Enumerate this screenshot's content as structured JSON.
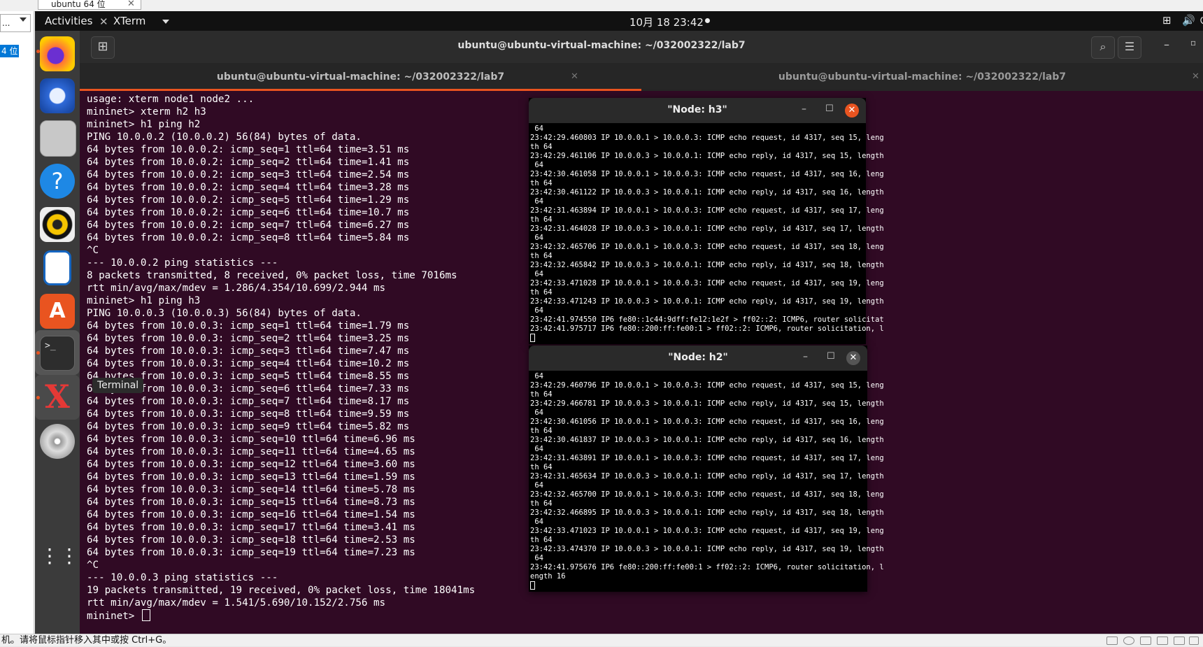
{
  "host": {
    "tab_title": "ubuntu 64 位",
    "left_select": "...",
    "left_item": "4 位",
    "status_text": "机。请将鼠标指针移入其中或按 Ctrl+G。"
  },
  "topbar": {
    "activities": "Activities",
    "app_name": "XTerm",
    "clock": "10月 18  23:42"
  },
  "dock": {
    "tooltip": "Terminal",
    "icons": [
      "firefox-icon",
      "thunderbird-icon",
      "files-icon",
      "help-icon",
      "rhythmbox-icon",
      "writer-icon",
      "software-icon",
      "terminal-icon",
      "xterm-icon",
      "dvd-icon",
      "show-apps-icon"
    ]
  },
  "terminal": {
    "title": "ubuntu@ubuntu-virtual-machine: ~/032002322/lab7",
    "tabs": [
      {
        "label": "ubuntu@ubuntu-virtual-machine: ~/032002322/lab7"
      },
      {
        "label": "ubuntu@ubuntu-virtual-machine: ~/032002322/lab7"
      }
    ],
    "lines": [
      "usage: xterm node1 node2 ...",
      "mininet> xterm h2 h3",
      "mininet> h1 ping h2",
      "PING 10.0.0.2 (10.0.0.2) 56(84) bytes of data.",
      "64 bytes from 10.0.0.2: icmp_seq=1 ttl=64 time=3.51 ms",
      "64 bytes from 10.0.0.2: icmp_seq=2 ttl=64 time=1.41 ms",
      "64 bytes from 10.0.0.2: icmp_seq=3 ttl=64 time=2.54 ms",
      "64 bytes from 10.0.0.2: icmp_seq=4 ttl=64 time=3.28 ms",
      "64 bytes from 10.0.0.2: icmp_seq=5 ttl=64 time=1.29 ms",
      "64 bytes from 10.0.0.2: icmp_seq=6 ttl=64 time=10.7 ms",
      "64 bytes from 10.0.0.2: icmp_seq=7 ttl=64 time=6.27 ms",
      "64 bytes from 10.0.0.2: icmp_seq=8 ttl=64 time=5.84 ms",
      "^C",
      "--- 10.0.0.2 ping statistics ---",
      "8 packets transmitted, 8 received, 0% packet loss, time 7016ms",
      "rtt min/avg/max/mdev = 1.286/4.354/10.699/2.944 ms",
      "mininet> h1 ping h3",
      "PING 10.0.0.3 (10.0.0.3) 56(84) bytes of data.",
      "64 bytes from 10.0.0.3: icmp_seq=1 ttl=64 time=1.79 ms",
      "64 bytes from 10.0.0.3: icmp_seq=2 ttl=64 time=3.25 ms",
      "64 bytes from 10.0.0.3: icmp_seq=3 ttl=64 time=7.47 ms",
      "64 bytes from 10.0.0.3: icmp_seq=4 ttl=64 time=10.2 ms",
      "64 bytes from 10.0.0.3: icmp_seq=5 ttl=64 time=8.55 ms",
      "64 bytes from 10.0.0.3: icmp_seq=6 ttl=64 time=7.33 ms",
      "64 bytes from 10.0.0.3: icmp_seq=7 ttl=64 time=8.17 ms",
      "64 bytes from 10.0.0.3: icmp_seq=8 ttl=64 time=9.59 ms",
      "64 bytes from 10.0.0.3: icmp_seq=9 ttl=64 time=5.82 ms",
      "64 bytes from 10.0.0.3: icmp_seq=10 ttl=64 time=6.96 ms",
      "64 bytes from 10.0.0.3: icmp_seq=11 ttl=64 time=4.65 ms",
      "64 bytes from 10.0.0.3: icmp_seq=12 ttl=64 time=3.60 ms",
      "64 bytes from 10.0.0.3: icmp_seq=13 ttl=64 time=1.59 ms",
      "64 bytes from 10.0.0.3: icmp_seq=14 ttl=64 time=5.78 ms",
      "64 bytes from 10.0.0.3: icmp_seq=15 ttl=64 time=8.73 ms",
      "64 bytes from 10.0.0.3: icmp_seq=16 ttl=64 time=1.54 ms",
      "64 bytes from 10.0.0.3: icmp_seq=17 ttl=64 time=3.41 ms",
      "64 bytes from 10.0.0.3: icmp_seq=18 ttl=64 time=2.53 ms",
      "64 bytes from 10.0.0.3: icmp_seq=19 ttl=64 time=7.23 ms",
      "^C",
      "--- 10.0.0.3 ping statistics ---",
      "19 packets transmitted, 19 received, 0% packet loss, time 18041ms",
      "rtt min/avg/max/mdev = 1.541/5.690/10.152/2.756 ms"
    ],
    "prompt": "mininet> "
  },
  "xterm_h3": {
    "title": "\"Node: h3\"",
    "lines": [
      " 64",
      "23:42:29.460803 IP 10.0.0.1 > 10.0.0.3: ICMP echo request, id 4317, seq 15, leng",
      "th 64",
      "23:42:29.461106 IP 10.0.0.3 > 10.0.0.1: ICMP echo reply, id 4317, seq 15, length",
      " 64",
      "23:42:30.461058 IP 10.0.0.1 > 10.0.0.3: ICMP echo request, id 4317, seq 16, leng",
      "th 64",
      "23:42:30.461122 IP 10.0.0.3 > 10.0.0.1: ICMP echo reply, id 4317, seq 16, length",
      " 64",
      "23:42:31.463894 IP 10.0.0.1 > 10.0.0.3: ICMP echo request, id 4317, seq 17, leng",
      "th 64",
      "23:42:31.464028 IP 10.0.0.3 > 10.0.0.1: ICMP echo reply, id 4317, seq 17, length",
      " 64",
      "23:42:32.465706 IP 10.0.0.1 > 10.0.0.3: ICMP echo request, id 4317, seq 18, leng",
      "th 64",
      "23:42:32.465842 IP 10.0.0.3 > 10.0.0.1: ICMP echo reply, id 4317, seq 18, length",
      " 64",
      "23:42:33.471028 IP 10.0.0.1 > 10.0.0.3: ICMP echo request, id 4317, seq 19, leng",
      "th 64",
      "23:42:33.471243 IP 10.0.0.3 > 10.0.0.1: ICMP echo reply, id 4317, seq 19, length",
      " 64",
      "23:42:41.974550 IP6 fe80::1c44:9dff:fe12:1e2f > ff02::2: ICMP6, router solicitat",
      "23:42:41.975717 IP6 fe80::200:ff:fe00:1 > ff02::2: ICMP6, router solicitation, l"
    ]
  },
  "xterm_h2": {
    "title": "\"Node: h2\"",
    "lines": [
      " 64",
      "23:42:29.460796 IP 10.0.0.1 > 10.0.0.3: ICMP echo request, id 4317, seq 15, leng",
      "th 64",
      "23:42:29.466781 IP 10.0.0.3 > 10.0.0.1: ICMP echo reply, id 4317, seq 15, length",
      " 64",
      "23:42:30.461056 IP 10.0.0.1 > 10.0.0.3: ICMP echo request, id 4317, seq 16, leng",
      "th 64",
      "23:42:30.461837 IP 10.0.0.3 > 10.0.0.1: ICMP echo reply, id 4317, seq 16, length",
      " 64",
      "23:42:31.463891 IP 10.0.0.1 > 10.0.0.3: ICMP echo request, id 4317, seq 17, leng",
      "th 64",
      "23:42:31.465634 IP 10.0.0.3 > 10.0.0.1: ICMP echo reply, id 4317, seq 17, length",
      " 64",
      "23:42:32.465700 IP 10.0.0.1 > 10.0.0.3: ICMP echo request, id 4317, seq 18, leng",
      "th 64",
      "23:42:32.466895 IP 10.0.0.3 > 10.0.0.1: ICMP echo reply, id 4317, seq 18, length",
      " 64",
      "23:42:33.471023 IP 10.0.0.1 > 10.0.0.3: ICMP echo request, id 4317, seq 19, leng",
      "th 64",
      "23:42:33.474370 IP 10.0.0.3 > 10.0.0.1: ICMP echo reply, id 4317, seq 19, length",
      " 64",
      "23:42:41.975676 IP6 fe80::200:ff:fe00:1 > ff02::2: ICMP6, router solicitation, l",
      "ength 16"
    ]
  }
}
